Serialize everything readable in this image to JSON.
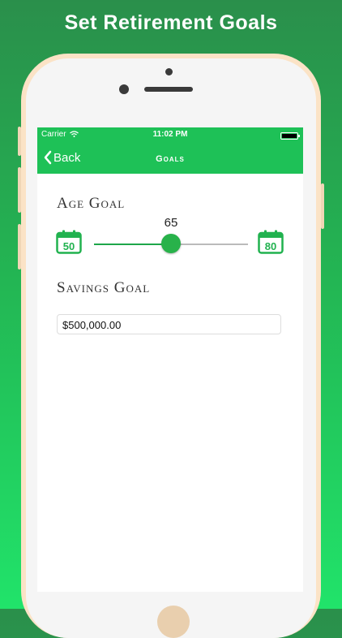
{
  "headline": "Set Retirement Goals",
  "status_bar": {
    "carrier": "Carrier",
    "time": "11:02 PM"
  },
  "nav": {
    "back_label": "Back",
    "title": "Goals"
  },
  "age_goal": {
    "label": "Age Goal",
    "min_label": "50",
    "max_label": "80",
    "min": 50,
    "max": 80,
    "value": 65,
    "value_label": "65"
  },
  "savings_goal": {
    "label": "Savings Goal",
    "value": "$500,000.00"
  },
  "colors": {
    "accent": "#1ec157",
    "thumb": "#28b24a"
  }
}
